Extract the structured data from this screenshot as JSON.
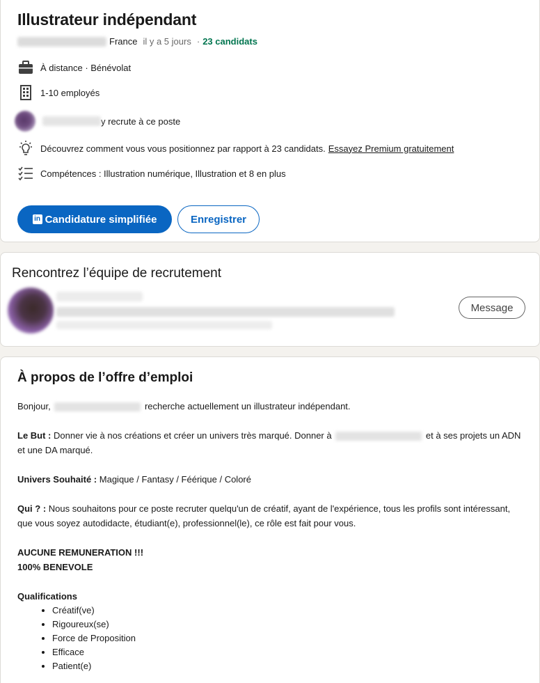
{
  "job": {
    "title": "Illustrateur indépendant",
    "location": "France",
    "posted": "il y a 5 jours",
    "separator": "·",
    "applicants": "23 candidats"
  },
  "info": {
    "workplace": "À distance · Bénévolat",
    "company_size": "1-10 employés",
    "recruiter_suffix": "y recrute à ce poste",
    "premium_text": "Découvrez comment vous vous positionnez par rapport à 23 candidats.",
    "premium_link": "Essayez Premium gratuitement",
    "skills": "Compétences : Illustration numérique, Illustration et 8 en plus"
  },
  "actions": {
    "apply_label": "Candidature simplifiée",
    "apply_logo": "in",
    "save_label": "Enregistrer"
  },
  "team": {
    "title": "Rencontrez l’équipe de recrutement",
    "message_label": "Message"
  },
  "about": {
    "title": "À propos de l’offre d’emploi",
    "intro_pre": "Bonjour,",
    "intro_post": "recherche actuellement un illustrateur indépendant.",
    "but_label": "Le But :",
    "but_pre": "Donner vie à nos créations et créer un univers très marqué. Donner à",
    "but_post": "et à ses projets un ADN et une DA marqué.",
    "univers_label": "Univers Souhaité :",
    "univers_text": "Magique / Fantasy / Féérique / Coloré",
    "qui_label": "Qui ? :",
    "qui_text": "Nous souhaitons pour ce poste recruter quelqu'un de créatif, ayant de l'expérience, tous les profils sont intéressant, que vous soyez autodidacte, étudiant(e), professionnel(le), ce rôle est fait pour vous.",
    "remun_1": "AUCUNE REMUNERATION !!!",
    "remun_2": "100% BENEVOLE",
    "qualifications_title": "Qualifications",
    "qualifications": [
      "Créatif(ve)",
      "Rigoureux(se)",
      "Force de Proposition",
      "Efficace",
      "Patient(e)"
    ]
  },
  "icons": {
    "workplace": "briefcase-icon",
    "company": "building-icon",
    "premium": "lightbulb-icon",
    "skills": "checklist-icon"
  },
  "colors": {
    "primary": "#0a66c2",
    "applicants": "#01754f"
  }
}
